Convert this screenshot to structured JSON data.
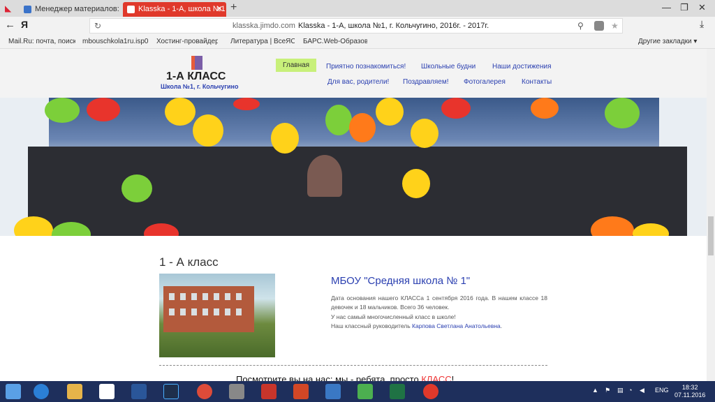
{
  "browser": {
    "tabs": [
      {
        "label": "Менеджер материалов: Из"
      },
      {
        "label": "Klasska - 1-А, школа №1",
        "active": true
      }
    ],
    "new_tab": "+",
    "address": {
      "domain": "klasska.jimdo.com",
      "title": "Klasska - 1-А, школа №1, г. Кольчугино, 2016г. - 2017г."
    },
    "yandex_button": "Я",
    "bookmarks": [
      "Mail.Ru: почта, поиск",
      "mbouschkola1ru.isp0",
      "Хостинг-провайдер",
      "Литература | ВсеЯСв",
      "БАРС.Web-Образова"
    ],
    "other_bookmarks": "Другие закладки ▾"
  },
  "site": {
    "logo_title": "1-А КЛАСС",
    "logo_subtitle": "Школа №1, г. Кольчугино",
    "nav": [
      {
        "label": "Главная",
        "active": true
      },
      {
        "label": "Приятно познакомиться!"
      },
      {
        "label": "Школьные будни"
      },
      {
        "label": "Наши достижения"
      },
      {
        "label": "Для вас, родители!"
      },
      {
        "label": "Поздравляем!"
      },
      {
        "label": "Фотогалерея"
      },
      {
        "label": "Контакты"
      }
    ],
    "content_title": "1 - А класс",
    "school_heading": "МБОУ \"Средняя школа № 1\"",
    "desc_lines": [
      "Дата основания нашего КЛАССа 1 сентября 2016 года. В нашем классе 18 девочек и 18 мальчиков. Всего 36 человек.",
      "У нас самый многочисленный класс в школе!",
      "Наш классный руководитель "
    ],
    "teacher_name": "Карпова Светлана Анатольевна",
    "desc_end": ".",
    "cut_line_start": "Посмотрите вы на нас: мы - ребята, просто ",
    "cut_line_red": "КЛАСС",
    "cut_line_end": "!"
  },
  "taskbar": {
    "lang": "ENG",
    "time": "18:32",
    "date": "07.11.2016"
  },
  "colors": {
    "accent_red": "#e0392b",
    "nav_active": "#c8f07a",
    "link_blue": "#2a3fb0",
    "taskbar": "#1e2f5c"
  }
}
